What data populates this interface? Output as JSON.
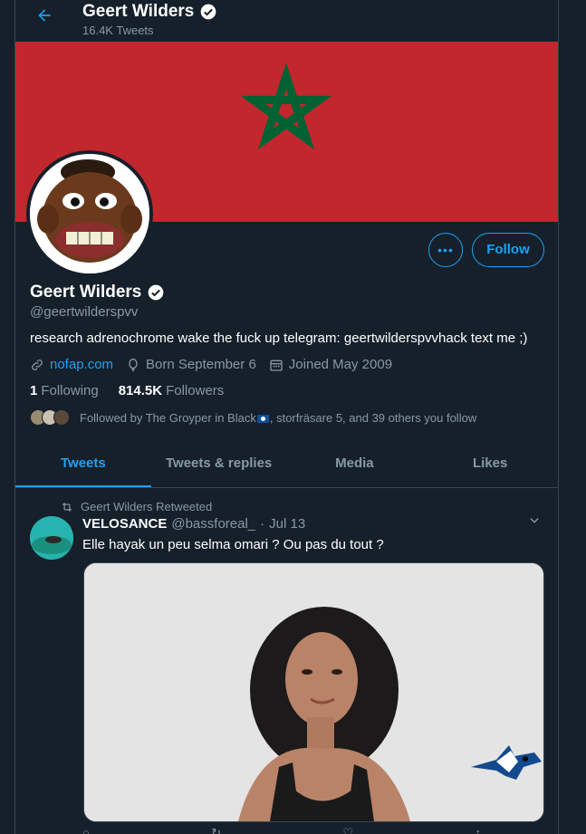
{
  "header": {
    "back_icon": "arrow-left-icon",
    "name": "Geert Wilders",
    "tweet_count": "16.4K Tweets"
  },
  "banner": {
    "description_colors": {
      "red": "#c1272d",
      "star": "#006233"
    }
  },
  "profile": {
    "name": "Geert Wilders",
    "handle": "@geertwilderspvv",
    "bio": "research adrenochrome wake the fuck up telegram: geertwilderspvvhack text me ;)",
    "website": "nofap.com",
    "birthday": "Born September 6",
    "joined": "Joined May 2009",
    "following_count": "1",
    "following_label": "Following",
    "followers_count": "814.5K",
    "followers_label": "Followers",
    "followed_by_pre": "Followed by The Groyper in Black",
    "followed_by_post": ", storfräsare 5, and 39 others you follow",
    "more_label": "•••",
    "follow_label": "Follow"
  },
  "tabs": [
    {
      "label": "Tweets",
      "active": true
    },
    {
      "label": "Tweets & replies",
      "active": false
    },
    {
      "label": "Media",
      "active": false
    },
    {
      "label": "Likes",
      "active": false
    }
  ],
  "tweet": {
    "retweet_label": "Geert Wilders Retweeted",
    "author_name": "VELOSANCE",
    "author_handle": "@bassforeal_",
    "dot": "·",
    "date": "Jul 13",
    "text": "Elle hayak un peu selma omari ? Ou pas du tout ?"
  },
  "colors": {
    "background": "#15202b",
    "accent": "#1da1f2",
    "secondary_text": "#8899a6",
    "border": "#38444d"
  }
}
